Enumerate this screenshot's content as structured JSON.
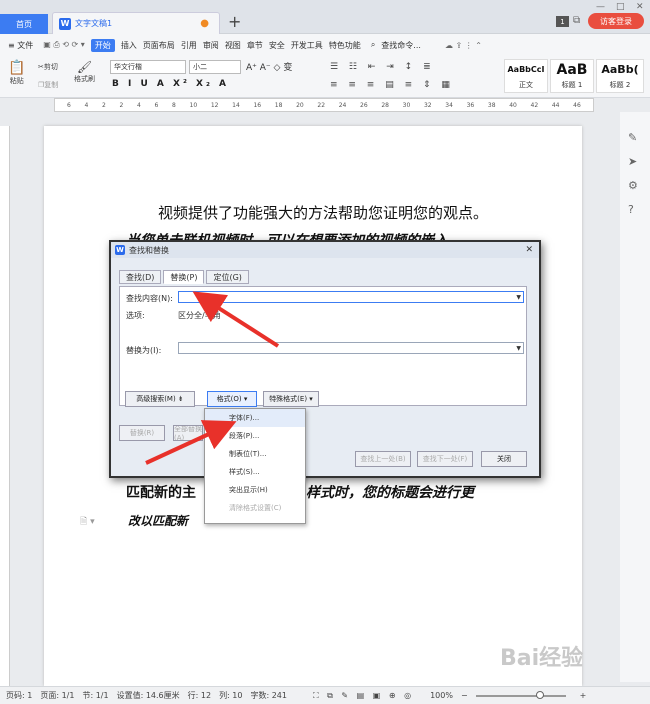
{
  "tabs": {
    "home": "首页",
    "doc_title": "文字文稿1",
    "modified_dot": "●",
    "add": "+"
  },
  "window": {
    "page_badge": "1",
    "visitor": "访客登录",
    "minimize": "—",
    "maximize": "□",
    "close": "✕"
  },
  "menu": {
    "file": "≡ 文件",
    "items": [
      "开始",
      "插入",
      "页面布局",
      "引用",
      "审阅",
      "视图",
      "章节",
      "安全",
      "开发工具",
      "特色功能"
    ],
    "search": "查找命令..."
  },
  "toolbar": {
    "paste": "粘贴",
    "cut": "剪切",
    "copy": "复制",
    "format_painter": "格式刷",
    "font": "华文行楷",
    "size": "小二",
    "styles": [
      {
        "preview": "AaBbCcI",
        "name": "正文"
      },
      {
        "preview": "AaB",
        "name": "标题 1"
      },
      {
        "preview": "AaBb(",
        "name": "标题 2"
      }
    ]
  },
  "ruler": {
    "ticks": [
      "6",
      "4",
      "2",
      "2",
      "4",
      "6",
      "8",
      "10",
      "12",
      "14",
      "16",
      "18",
      "20",
      "22",
      "24",
      "26",
      "28",
      "30",
      "32",
      "34",
      "36",
      "38",
      "40",
      "42",
      "44",
      "46"
    ]
  },
  "document": {
    "line1": "视频提供了功能强大的方法帮助您证明您的观点。",
    "line2": "当您单击联机视频时，可以在想要添加的视频的嵌入",
    "line3a": "匹配新的主",
    "line3b": "样式时，您的标题会进行更",
    "line4": "改以匹配新"
  },
  "dialog": {
    "title": "查找和替换",
    "tabs": [
      "查找(D)",
      "替换(P)",
      "定位(G)"
    ],
    "find_label": "查找内容(N):",
    "find_value": "",
    "options_label": "选项:",
    "options_value": "区分全/半角",
    "replace_label": "替换为(I):",
    "replace_value": "",
    "advanced": "高级搜索(M) ⇟",
    "format": "格式(O) ▾",
    "special": "特殊格式(E) ▾",
    "replace_btn": "替换(R)",
    "replace_all": "全部替换(A)",
    "find_prev": "查找上一处(B)",
    "find_next": "查找下一处(F)",
    "close": "关闭"
  },
  "format_menu": [
    "字体(F)...",
    "段落(P)...",
    "制表位(T)...",
    "样式(S)...",
    "突出显示(H)",
    "清除格式设置(C)"
  ],
  "status": {
    "page": "页码: 1",
    "pages": "页面: 1/1",
    "section": "节: 1/1",
    "setting": "设置值: 14.6厘米",
    "row": "行: 12",
    "col": "列: 10",
    "words": "字数: 241",
    "zoom": "100%"
  },
  "watermark": "Bai经验",
  "colors": {
    "accent": "#3c7cf2",
    "arrow": "#e8312a",
    "visitor": "#e94e3f"
  }
}
